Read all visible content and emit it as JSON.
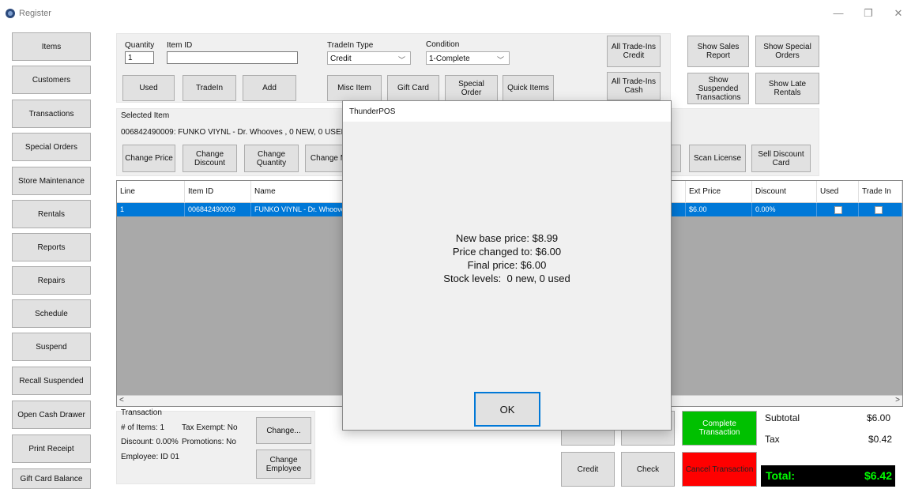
{
  "window": {
    "title": "Register",
    "minimize": "—",
    "restore": "❐",
    "close": "✕"
  },
  "nav": [
    "Items",
    "Customers",
    "Transactions",
    "Special Orders",
    "Store Maintenance",
    "Rentals",
    "Reports",
    "Repairs",
    "Schedule",
    "Suspend",
    "Recall Suspended",
    "Open Cash Drawer",
    "Print Receipt",
    "Gift Card Balance"
  ],
  "entry": {
    "quantity_label": "Quantity",
    "quantity_value": "1",
    "item_id_label": "Item ID",
    "item_id_value": "",
    "used_btn": "Used",
    "tradein_btn": "TradeIn",
    "add_btn": "Add",
    "tradein_type_label": "TradeIn Type",
    "tradein_type_value": "Credit",
    "condition_label": "Condition",
    "condition_value": "1-Complete",
    "misc_item_btn": "Misc Item",
    "gift_card_btn": "Gift Card",
    "special_order_btn": "Special Order",
    "quick_items_btn": "Quick Items",
    "all_tradeins_credit_btn": "All Trade-Ins\nCredit",
    "all_tradeins_cash_btn": "All Trade-Ins\nCash",
    "show_sales_report_btn": "Show Sales\nReport",
    "show_special_orders_btn": "Show Special\nOrders",
    "show_suspended_btn": "Show\nSuspended\nTransactions",
    "show_late_rentals_btn": "Show Late\nRentals"
  },
  "selected": {
    "label": "Selected Item",
    "text": "006842490009: FUNKO VIYNL - Dr. Whooves , 0 NEW, 0 USED",
    "change_price_btn": "Change Price",
    "change_discount_btn": "Change\nDiscount",
    "change_quantity_btn": "Change\nQuantity",
    "change_m_btn": "Change M",
    "scan_license_btn": "Scan License",
    "sell_discount_card_btn": "Sell Discount\nCard"
  },
  "grid": {
    "headers": {
      "line": "Line",
      "item_id": "Item ID",
      "name": "Name",
      "ext_price": "Ext Price",
      "discount": "Discount",
      "used": "Used",
      "trade_in": "Trade In"
    },
    "rows": [
      {
        "line": "1",
        "item_id": "006842490009",
        "name": "FUNKO VIYNL - Dr. Whoove",
        "ext_price": "$6.00",
        "discount": "0.00%"
      }
    ],
    "scroll_left": "<",
    "scroll_right": ">"
  },
  "transaction": {
    "label": "Transaction",
    "items": "# of Items: 1",
    "tax_exempt": "Tax Exempt: No",
    "discount": "Discount: 0.00%",
    "promotions": "Promotions: No",
    "employee": "Employee: ID 01",
    "change_btn": "Change...",
    "change_employee_btn": "Change\nEmployee"
  },
  "payment": {
    "credit_btn": "Credit",
    "check_btn": "Check",
    "complete_btn": "Complete Transaction",
    "cancel_btn": "Cancel Transaction"
  },
  "totals": {
    "subtotal_label": "Subtotal",
    "subtotal_value": "$6.00",
    "tax_label": "Tax",
    "tax_value": "$0.42",
    "total_label": "Total:",
    "total_value": "$6.42"
  },
  "dialog": {
    "title": "ThunderPOS",
    "line1": "New base price: $8.99",
    "line2": "Price changed to: $6.00",
    "line3": "Final price: $6.00",
    "line4": "Stock levels:  0 new, 0 used",
    "ok": "OK"
  },
  "colors": {
    "selection": "#0078d7",
    "complete": "#00c000",
    "cancel": "#ff0000",
    "total_bg": "#000000",
    "total_text": "#00ff00"
  }
}
